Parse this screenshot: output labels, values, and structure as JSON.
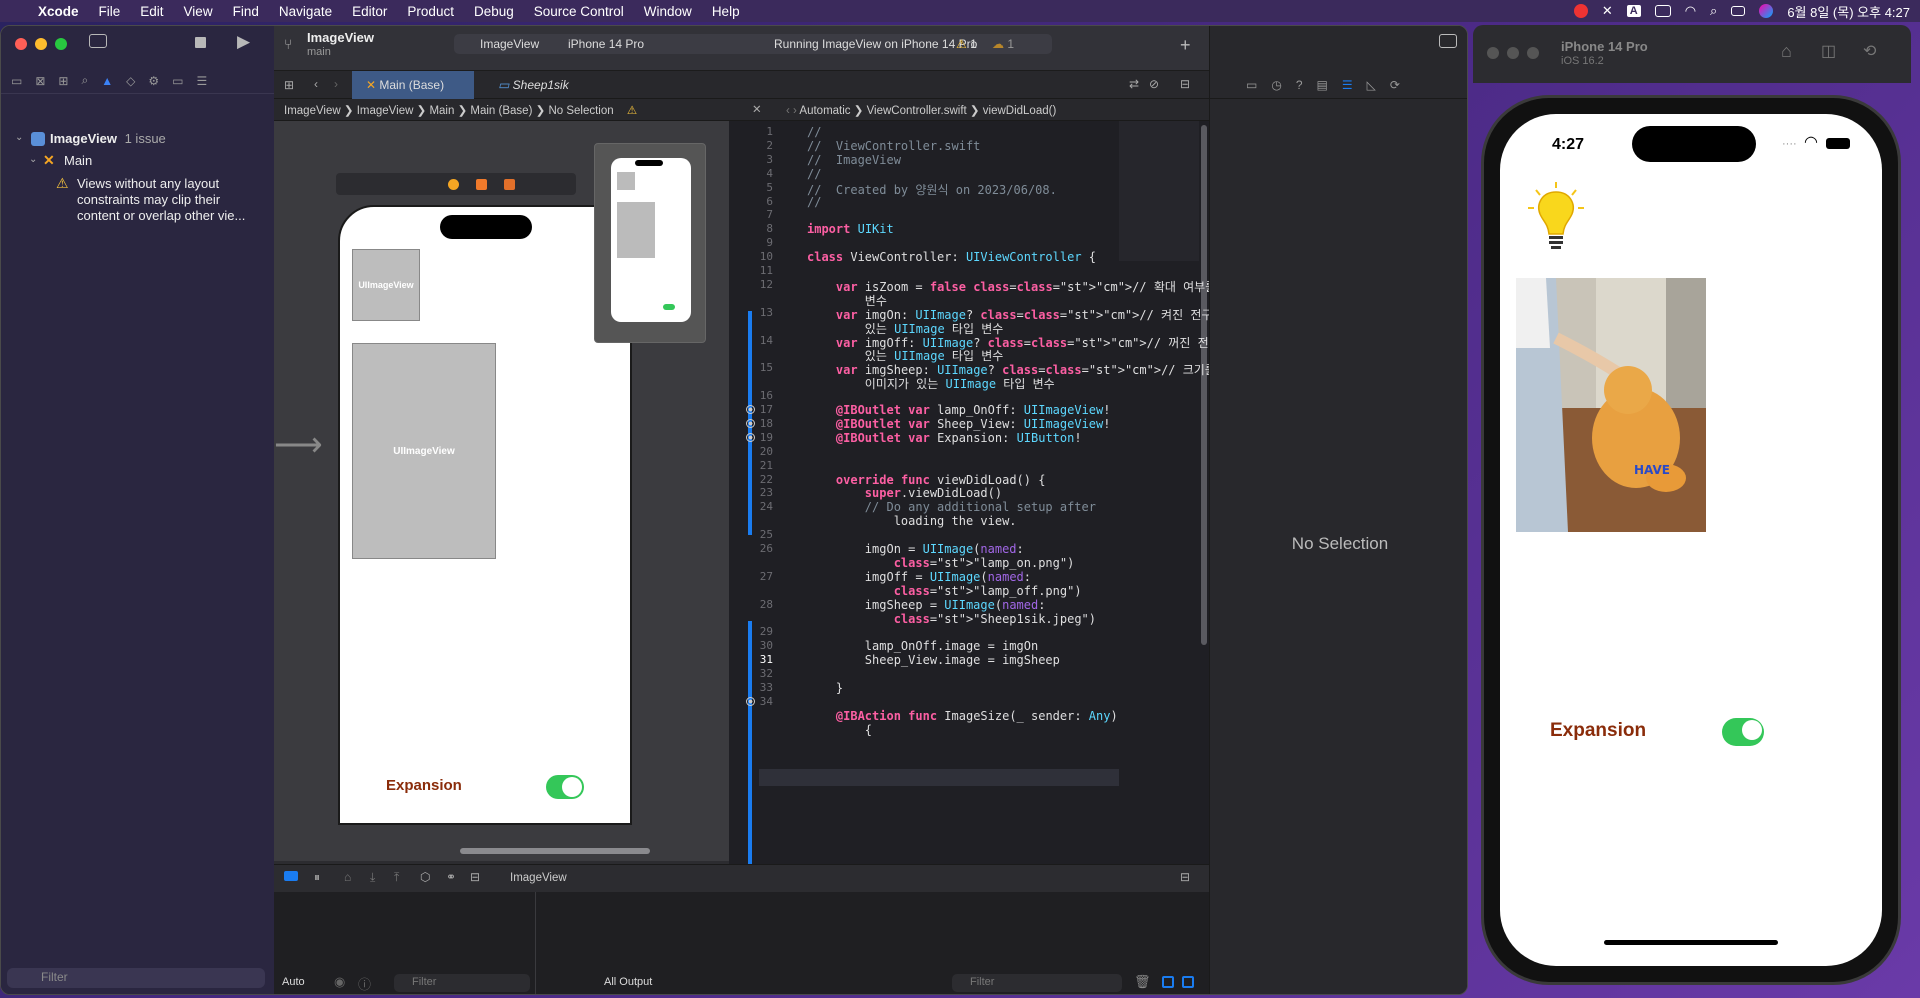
{
  "menubar": {
    "app_name": "Xcode",
    "items": [
      "File",
      "Edit",
      "View",
      "Find",
      "Navigate",
      "Editor",
      "Product",
      "Debug",
      "Source Control",
      "Window",
      "Help"
    ],
    "datetime": "6월 8일 (목) 오후 4:27"
  },
  "navigator": {
    "project_name": "ImageView",
    "issue_count_label": "1 issue",
    "group_name": "Main",
    "issue_text": "Views without any layout constraints may clip their content or overlap other vie...",
    "filter_placeholder": "Filter"
  },
  "toolbar": {
    "project_title": "ImageView",
    "branch": "main",
    "scheme": "ImageView",
    "device": "iPhone 14 Pro",
    "status": "Running ImageView on iPhone 14 Pro",
    "warning_count": "1",
    "issue_count": "1"
  },
  "tabs": [
    {
      "label": "Main (Base)"
    },
    {
      "label": "Sheep1sik"
    }
  ],
  "jumpbar_left": [
    "ImageView",
    "ImageView",
    "Main",
    "Main (Base)",
    "No Selection"
  ],
  "jumpbar_right": [
    "Automatic",
    "ViewController.swift",
    "viewDidLoad()"
  ],
  "storyboard": {
    "image_view_label_small": "UIImageView",
    "image_view_label_large": "UIImageView",
    "button_label": "Expansion",
    "device_label": "iPhone 14 Pro"
  },
  "code": {
    "line_numbers": [
      "1",
      "2",
      "3",
      "4",
      "5",
      "6",
      "7",
      "8",
      "9",
      "10",
      "11",
      "12",
      "13",
      "14",
      "15",
      "16",
      "17",
      "18",
      "19",
      "20",
      "21",
      "22",
      "23",
      "24",
      "25",
      "26",
      "27",
      "28",
      "29",
      "30",
      "31",
      "32",
      "33",
      "34"
    ],
    "lines": [
      "//",
      "//  ViewController.swift",
      "//  ImageView",
      "//",
      "//  Created by 양원식 on 2023/06/08.",
      "//",
      "",
      "import UIKit",
      "",
      "class ViewController: UIViewController {",
      "",
      "    var isZoom = false // 확대 여부를 나타내는",
      "        변수",
      "    var imgOn: UIImage? // 켜진 전구 이미지가",
      "        있는 UIImage 타입 변수",
      "    var imgOff: UIImage? // 꺼진 전구 이미지가",
      "        있는 UIImage 타입 변수",
      "    var imgSheep: UIImage? // 크기를 조절할",
      "        이미지가 있는 UIImage 타입 변수",
      "",
      "    @IBOutlet var lamp_OnOff: UIImageView!",
      "    @IBOutlet var Sheep_View: UIImageView!",
      "    @IBOutlet var Expansion: UIButton!",
      "",
      "",
      "    override func viewDidLoad() {",
      "        super.viewDidLoad()",
      "        // Do any additional setup after",
      "            loading the view.",
      "",
      "        imgOn = UIImage(named:",
      "            \"lamp_on.png\")",
      "        imgOff = UIImage(named:",
      "            \"lamp_off.png\")",
      "        imgSheep = UIImage(named:",
      "            \"Sheep1sik.jpeg\")",
      "",
      "        lamp_OnOff.image = imgOn",
      "        Sheep_View.image = imgSheep",
      "",
      "    }",
      "",
      "    @IBAction func ImageSize(_ sender: Any)",
      "        {"
    ]
  },
  "inspector": {
    "empty_label": "No Selection"
  },
  "debug": {
    "target": "ImageView",
    "auto_label": "Auto",
    "all_output": "All Output",
    "filter_placeholder": "Filter"
  },
  "simulator": {
    "device_name": "iPhone 14 Pro",
    "os_version": "iOS 16.2",
    "time": "4:27",
    "button_label": "Expansion",
    "switch_on": true
  }
}
